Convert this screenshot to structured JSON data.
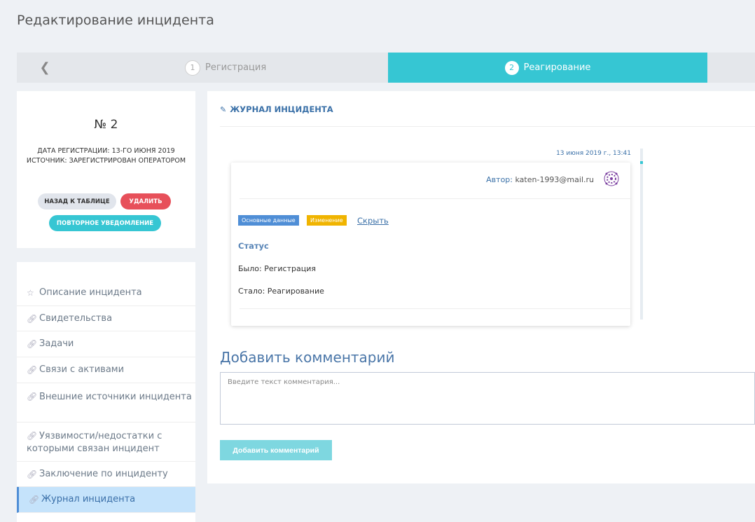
{
  "page": {
    "title": "Редактирование инцидента"
  },
  "stepper": {
    "back_icon": "chevron-left-icon",
    "steps": [
      {
        "num": "1",
        "label": "Регистрация",
        "state": "done"
      },
      {
        "num": "2",
        "label": "Реагирование",
        "state": "active"
      }
    ],
    "active_color": "#36c6d3"
  },
  "incident": {
    "number": "№ 2",
    "reg_date": "Дата регистрации: 13-го июня 2019",
    "source": "Источник: Зарегистрирован оператором"
  },
  "actions": {
    "back_label": "Назад к таблице",
    "delete_label": "Удалить",
    "notify_label": "Повторное уведомление"
  },
  "sidebar": {
    "items": [
      {
        "label": "Описание инцидента",
        "icon": "star-icon"
      },
      {
        "label": "Свидетельства",
        "icon": "link-icon"
      },
      {
        "label": "Задачи",
        "icon": "link-icon"
      },
      {
        "label": "Связи с активами",
        "icon": "link-icon"
      },
      {
        "label": "Внешние источники инцидента",
        "icon": "link-icon"
      },
      {
        "label": "Уязвимости/недостатки с которыми связан инцидент",
        "icon": "link-icon"
      },
      {
        "label": "Заключение по инциденту",
        "icon": "link-icon"
      },
      {
        "label": "Журнал инцидента",
        "icon": "link-icon",
        "active": true
      }
    ]
  },
  "journal": {
    "title": "ЖУРНАЛ ИНЦИДЕНТА",
    "entry": {
      "time": "13 июня 2019 г., 13:41",
      "author_label": "Автор:",
      "author": "katen-1993@mail.ru",
      "badges": [
        "Основные данные",
        "Изменение"
      ],
      "hide_link": "Скрыть",
      "field": "Статус",
      "was": "Было: Регистрация",
      "now": "Стало: Реагирование"
    }
  },
  "comment": {
    "title": "Добавить комментарий",
    "placeholder": "Введите текст комментария...",
    "button": "Добавить комментарий"
  },
  "colors": {
    "accent": "#36c6d3",
    "danger": "#e7505a",
    "link": "#3b71a8",
    "badge_blue": "#4f8ed6",
    "badge_yellow": "#f0b400"
  }
}
